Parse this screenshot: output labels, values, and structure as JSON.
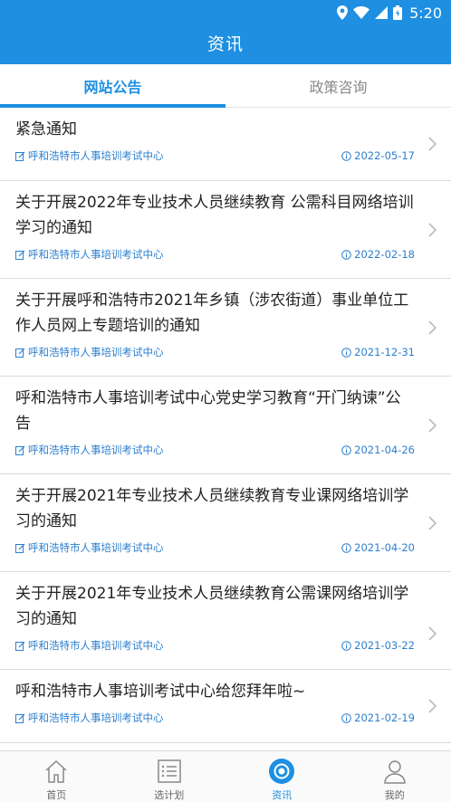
{
  "status_bar": {
    "time": "5:20"
  },
  "header": {
    "title": "资讯"
  },
  "tabs": [
    {
      "label": "网站公告",
      "active": true
    },
    {
      "label": "政策咨询",
      "active": false
    }
  ],
  "articles": [
    {
      "title": "紧急通知",
      "source": "呼和浩特市人事培训考试中心",
      "date": "2022-05-17"
    },
    {
      "title": "关于开展2022年专业技术人员继续教育 公需科目网络培训学习的通知",
      "source": "呼和浩特市人事培训考试中心",
      "date": "2022-02-18"
    },
    {
      "title": "关于开展呼和浩特市2021年乡镇（涉农街道）事业单位工作人员网上专题培训的通知",
      "source": "呼和浩特市人事培训考试中心",
      "date": "2021-12-31"
    },
    {
      "title": "呼和浩特市人事培训考试中心党史学习教育“开门纳谏”公告",
      "source": "呼和浩特市人事培训考试中心",
      "date": "2021-04-26"
    },
    {
      "title": "关于开展2021年专业技术人员继续教育专业课网络培训学习的通知",
      "source": "呼和浩特市人事培训考试中心",
      "date": "2021-04-20"
    },
    {
      "title": "关于开展2021年专业技术人员继续教育公需课网络培训学习的通知",
      "source": "呼和浩特市人事培训考试中心",
      "date": "2021-03-22"
    },
    {
      "title": "呼和浩特市人事培训考试中心给您拜年啦~",
      "source": "呼和浩特市人事培训考试中心",
      "date": "2021-02-19"
    }
  ],
  "bottom_nav": [
    {
      "label": "首页",
      "icon": "home-icon",
      "active": false
    },
    {
      "label": "选计划",
      "icon": "list-icon",
      "active": false
    },
    {
      "label": "资讯",
      "icon": "target-icon",
      "active": true
    },
    {
      "label": "我的",
      "icon": "user-icon",
      "active": false
    }
  ],
  "colors": {
    "accent": "#1E8FE1",
    "meta": "#2C7FCF",
    "text": "#222222"
  }
}
